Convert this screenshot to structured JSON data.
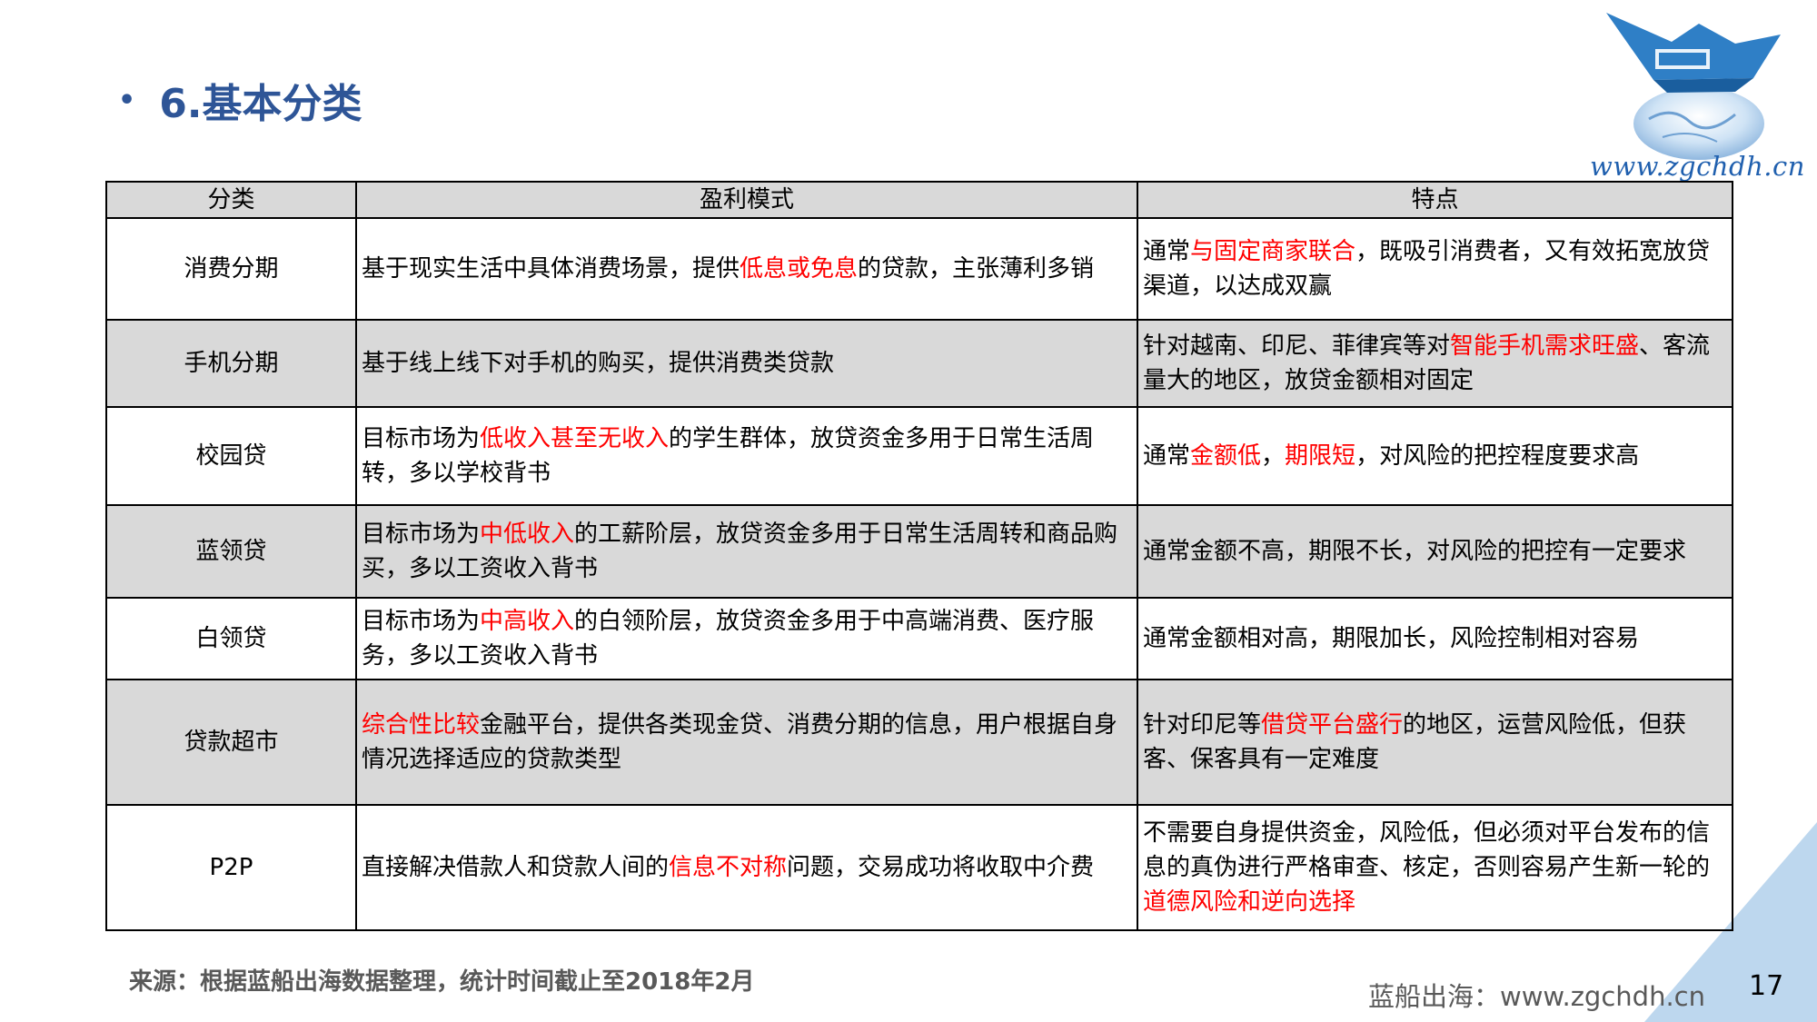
{
  "slide": {
    "bullet": "•",
    "title": "6.基本分类",
    "logo_url": "www.zgchdh.cn",
    "source": "来源：根据蓝船出海数据整理，统计时间截止至2018年2月",
    "footer_site": "蓝船出海：www.zgchdh.cn",
    "page_number": "17"
  },
  "table": {
    "headers": [
      "分类",
      "盈利模式",
      "特点"
    ],
    "rows": [
      {
        "category": "消费分期",
        "model": [
          {
            "t": "基于现实生活中具体消费场景，提供",
            "hl": false
          },
          {
            "t": "低息或免息",
            "hl": true
          },
          {
            "t": "的贷款，主张薄利多销",
            "hl": false
          }
        ],
        "feature": [
          {
            "t": "通常",
            "hl": false
          },
          {
            "t": "与固定商家联合",
            "hl": true
          },
          {
            "t": "，既吸引消费者，又有效拓宽放贷渠道，以达成双赢",
            "hl": false
          }
        ]
      },
      {
        "category": "手机分期",
        "model": [
          {
            "t": "基于线上线下对手机的购买，提供消费类贷款",
            "hl": false
          }
        ],
        "feature": [
          {
            "t": "针对越南、印尼、菲律宾等对",
            "hl": false
          },
          {
            "t": "智能手机需求旺盛",
            "hl": true
          },
          {
            "t": "、客流量大的地区，放贷金额相对固定",
            "hl": false
          }
        ]
      },
      {
        "category": "校园贷",
        "model": [
          {
            "t": "目标市场为",
            "hl": false
          },
          {
            "t": "低收入甚至无收入",
            "hl": true
          },
          {
            "t": "的学生群体，放贷资金多用于日常生活周转，多以学校背书",
            "hl": false
          }
        ],
        "feature": [
          {
            "t": "通常",
            "hl": false
          },
          {
            "t": "金额低",
            "hl": true
          },
          {
            "t": "，",
            "hl": false
          },
          {
            "t": "期限短",
            "hl": true
          },
          {
            "t": "，对风险的把控程度要求高",
            "hl": false
          }
        ]
      },
      {
        "category": "蓝领贷",
        "model": [
          {
            "t": "目标市场为",
            "hl": false
          },
          {
            "t": "中低收入",
            "hl": true
          },
          {
            "t": "的工薪阶层，放贷资金多用于日常生活周转和商品购买，多以工资收入背书",
            "hl": false
          }
        ],
        "feature": [
          {
            "t": "通常金额不高，期限不长，对风险的把控有一定要求",
            "hl": false
          }
        ]
      },
      {
        "category": "白领贷",
        "model": [
          {
            "t": "目标市场为",
            "hl": false
          },
          {
            "t": "中高收入",
            "hl": true
          },
          {
            "t": "的白领阶层，放贷资金多用于中高端消费、医疗服务，多以工资收入背书",
            "hl": false
          }
        ],
        "feature": [
          {
            "t": "通常金额相对高，期限加长，风险控制相对容易",
            "hl": false
          }
        ]
      },
      {
        "category": "贷款超市",
        "model": [
          {
            "t": "综合性比较",
            "hl": true
          },
          {
            "t": "金融平台，提供各类现金贷、消费分期的信息，用户根据自身情况选择适应的贷款类型",
            "hl": false
          }
        ],
        "feature": [
          {
            "t": "针对印尼等",
            "hl": false
          },
          {
            "t": "借贷平台盛行",
            "hl": true
          },
          {
            "t": "的地区，运营风险低，但获客、保客具有一定难度",
            "hl": false
          }
        ]
      },
      {
        "category": "P2P",
        "model": [
          {
            "t": "直接解决借款人和贷款人间的",
            "hl": false
          },
          {
            "t": "信息不对称",
            "hl": true
          },
          {
            "t": "问题，交易成功将收取中介费",
            "hl": false
          }
        ],
        "feature": [
          {
            "t": "不需要自身提供资金，风险低，但必须对平台发布的信息的真伪进行严格审查、核定，否则容易产生新一轮的",
            "hl": false
          },
          {
            "t": "道德风险和逆向选择",
            "hl": true
          }
        ]
      }
    ]
  },
  "colors": {
    "title": "#2e5597",
    "highlight": "#ff0000",
    "header_bg": "#d9d9d9",
    "corner_triangle": "#bdd7ee"
  },
  "icons": {
    "logo": "paper-boat-globe-logo"
  }
}
